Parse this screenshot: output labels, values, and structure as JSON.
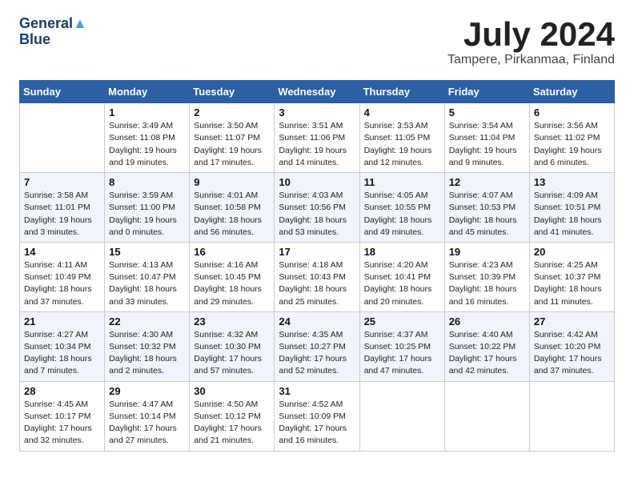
{
  "header": {
    "logo_line1": "General",
    "logo_line2": "Blue",
    "month_title": "July 2024",
    "subtitle": "Tampere, Pirkanmaa, Finland"
  },
  "columns": [
    "Sunday",
    "Monday",
    "Tuesday",
    "Wednesday",
    "Thursday",
    "Friday",
    "Saturday"
  ],
  "weeks": [
    [
      {
        "day": "",
        "sunrise": "",
        "sunset": "",
        "daylight": ""
      },
      {
        "day": "1",
        "sunrise": "Sunrise: 3:49 AM",
        "sunset": "Sunset: 11:08 PM",
        "daylight": "Daylight: 19 hours and 19 minutes."
      },
      {
        "day": "2",
        "sunrise": "Sunrise: 3:50 AM",
        "sunset": "Sunset: 11:07 PM",
        "daylight": "Daylight: 19 hours and 17 minutes."
      },
      {
        "day": "3",
        "sunrise": "Sunrise: 3:51 AM",
        "sunset": "Sunset: 11:06 PM",
        "daylight": "Daylight: 19 hours and 14 minutes."
      },
      {
        "day": "4",
        "sunrise": "Sunrise: 3:53 AM",
        "sunset": "Sunset: 11:05 PM",
        "daylight": "Daylight: 19 hours and 12 minutes."
      },
      {
        "day": "5",
        "sunrise": "Sunrise: 3:54 AM",
        "sunset": "Sunset: 11:04 PM",
        "daylight": "Daylight: 19 hours and 9 minutes."
      },
      {
        "day": "6",
        "sunrise": "Sunrise: 3:56 AM",
        "sunset": "Sunset: 11:02 PM",
        "daylight": "Daylight: 19 hours and 6 minutes."
      }
    ],
    [
      {
        "day": "7",
        "sunrise": "Sunrise: 3:58 AM",
        "sunset": "Sunset: 11:01 PM",
        "daylight": "Daylight: 19 hours and 3 minutes."
      },
      {
        "day": "8",
        "sunrise": "Sunrise: 3:59 AM",
        "sunset": "Sunset: 11:00 PM",
        "daylight": "Daylight: 19 hours and 0 minutes."
      },
      {
        "day": "9",
        "sunrise": "Sunrise: 4:01 AM",
        "sunset": "Sunset: 10:58 PM",
        "daylight": "Daylight: 18 hours and 56 minutes."
      },
      {
        "day": "10",
        "sunrise": "Sunrise: 4:03 AM",
        "sunset": "Sunset: 10:56 PM",
        "daylight": "Daylight: 18 hours and 53 minutes."
      },
      {
        "day": "11",
        "sunrise": "Sunrise: 4:05 AM",
        "sunset": "Sunset: 10:55 PM",
        "daylight": "Daylight: 18 hours and 49 minutes."
      },
      {
        "day": "12",
        "sunrise": "Sunrise: 4:07 AM",
        "sunset": "Sunset: 10:53 PM",
        "daylight": "Daylight: 18 hours and 45 minutes."
      },
      {
        "day": "13",
        "sunrise": "Sunrise: 4:09 AM",
        "sunset": "Sunset: 10:51 PM",
        "daylight": "Daylight: 18 hours and 41 minutes."
      }
    ],
    [
      {
        "day": "14",
        "sunrise": "Sunrise: 4:11 AM",
        "sunset": "Sunset: 10:49 PM",
        "daylight": "Daylight: 18 hours and 37 minutes."
      },
      {
        "day": "15",
        "sunrise": "Sunrise: 4:13 AM",
        "sunset": "Sunset: 10:47 PM",
        "daylight": "Daylight: 18 hours and 33 minutes."
      },
      {
        "day": "16",
        "sunrise": "Sunrise: 4:16 AM",
        "sunset": "Sunset: 10:45 PM",
        "daylight": "Daylight: 18 hours and 29 minutes."
      },
      {
        "day": "17",
        "sunrise": "Sunrise: 4:18 AM",
        "sunset": "Sunset: 10:43 PM",
        "daylight": "Daylight: 18 hours and 25 minutes."
      },
      {
        "day": "18",
        "sunrise": "Sunrise: 4:20 AM",
        "sunset": "Sunset: 10:41 PM",
        "daylight": "Daylight: 18 hours and 20 minutes."
      },
      {
        "day": "19",
        "sunrise": "Sunrise: 4:23 AM",
        "sunset": "Sunset: 10:39 PM",
        "daylight": "Daylight: 18 hours and 16 minutes."
      },
      {
        "day": "20",
        "sunrise": "Sunrise: 4:25 AM",
        "sunset": "Sunset: 10:37 PM",
        "daylight": "Daylight: 18 hours and 11 minutes."
      }
    ],
    [
      {
        "day": "21",
        "sunrise": "Sunrise: 4:27 AM",
        "sunset": "Sunset: 10:34 PM",
        "daylight": "Daylight: 18 hours and 7 minutes."
      },
      {
        "day": "22",
        "sunrise": "Sunrise: 4:30 AM",
        "sunset": "Sunset: 10:32 PM",
        "daylight": "Daylight: 18 hours and 2 minutes."
      },
      {
        "day": "23",
        "sunrise": "Sunrise: 4:32 AM",
        "sunset": "Sunset: 10:30 PM",
        "daylight": "Daylight: 17 hours and 57 minutes."
      },
      {
        "day": "24",
        "sunrise": "Sunrise: 4:35 AM",
        "sunset": "Sunset: 10:27 PM",
        "daylight": "Daylight: 17 hours and 52 minutes."
      },
      {
        "day": "25",
        "sunrise": "Sunrise: 4:37 AM",
        "sunset": "Sunset: 10:25 PM",
        "daylight": "Daylight: 17 hours and 47 minutes."
      },
      {
        "day": "26",
        "sunrise": "Sunrise: 4:40 AM",
        "sunset": "Sunset: 10:22 PM",
        "daylight": "Daylight: 17 hours and 42 minutes."
      },
      {
        "day": "27",
        "sunrise": "Sunrise: 4:42 AM",
        "sunset": "Sunset: 10:20 PM",
        "daylight": "Daylight: 17 hours and 37 minutes."
      }
    ],
    [
      {
        "day": "28",
        "sunrise": "Sunrise: 4:45 AM",
        "sunset": "Sunset: 10:17 PM",
        "daylight": "Daylight: 17 hours and 32 minutes."
      },
      {
        "day": "29",
        "sunrise": "Sunrise: 4:47 AM",
        "sunset": "Sunset: 10:14 PM",
        "daylight": "Daylight: 17 hours and 27 minutes."
      },
      {
        "day": "30",
        "sunrise": "Sunrise: 4:50 AM",
        "sunset": "Sunset: 10:12 PM",
        "daylight": "Daylight: 17 hours and 21 minutes."
      },
      {
        "day": "31",
        "sunrise": "Sunrise: 4:52 AM",
        "sunset": "Sunset: 10:09 PM",
        "daylight": "Daylight: 17 hours and 16 minutes."
      },
      {
        "day": "",
        "sunrise": "",
        "sunset": "",
        "daylight": ""
      },
      {
        "day": "",
        "sunrise": "",
        "sunset": "",
        "daylight": ""
      },
      {
        "day": "",
        "sunrise": "",
        "sunset": "",
        "daylight": ""
      }
    ]
  ]
}
